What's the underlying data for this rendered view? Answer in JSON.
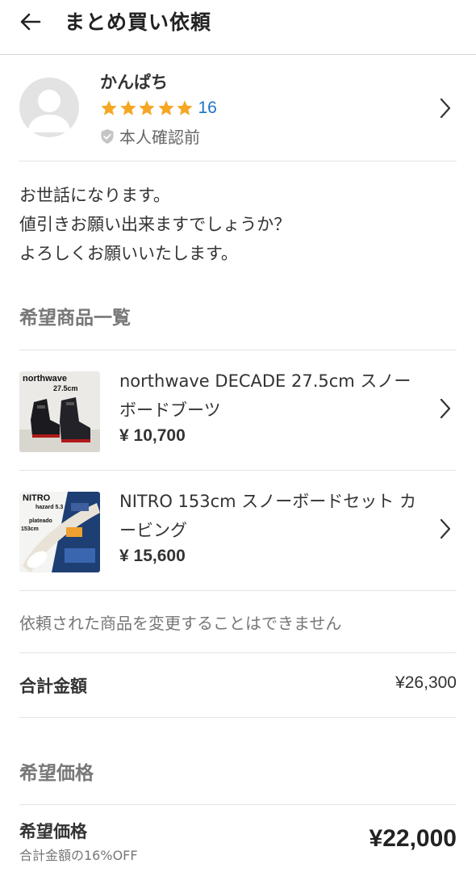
{
  "header": {
    "title": "まとめ買い依頼",
    "back_icon": "arrow-left-icon"
  },
  "seller": {
    "name": "かんぱち",
    "rating_stars": 5,
    "rating_count": "16",
    "verification": "本人確認前",
    "star_color": "#f5a623"
  },
  "message": {
    "lines": [
      "お世話になります。",
      "値引きお願い出来ますでしょうか？",
      "よろしくお願いいたします。"
    ]
  },
  "items_section": {
    "title": "希望商品一覧",
    "items": [
      {
        "name": "northwave DECADE 27.5cm スノーボードブーツ",
        "price": "¥ 10,700",
        "thumb_text_1": "northwave",
        "thumb_text_2": "27.5cm"
      },
      {
        "name": "NITRO 153cm スノーボードセット カービング",
        "price": "¥ 15,600",
        "thumb_text_1": "NITRO",
        "thumb_text_2": "hazard 5.3",
        "thumb_text_3": "plateado",
        "thumb_text_4": "153cm"
      }
    ]
  },
  "notice": "依頼された商品を変更することはできません",
  "total": {
    "label": "合計金額",
    "value": "¥26,300"
  },
  "desired_section": {
    "title": "希望価格",
    "label": "希望価格",
    "sub": "合計金額の16%OFF",
    "value": "¥22,000"
  }
}
